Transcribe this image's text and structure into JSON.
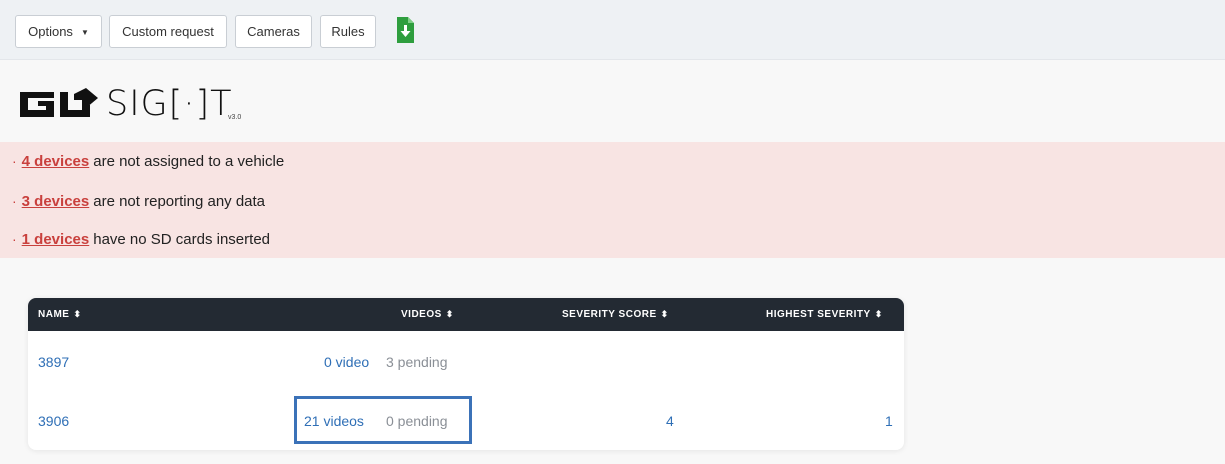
{
  "toolbar": {
    "options_label": "Options",
    "custom_request_label": "Custom request",
    "cameras_label": "Cameras",
    "rules_label": "Rules",
    "download_icon": "download-file-icon",
    "accent_color": "#2e9e3e"
  },
  "logo": {
    "word": "SIG[·]T",
    "version": "v3.0"
  },
  "alerts": [
    {
      "link": "4 devices",
      "text": "are not assigned to a vehicle"
    },
    {
      "link": "3 devices",
      "text": "are not reporting any data"
    },
    {
      "link": "1 devices",
      "text": "have no SD cards inserted"
    }
  ],
  "table": {
    "columns": [
      "NAME",
      "VIDEOS",
      "SEVERITY SCORE",
      "HIGHEST SEVERITY"
    ],
    "sort_icon": "⬍",
    "rows": [
      {
        "name": "3897",
        "videos": "0 video",
        "pending": "3 pending",
        "severity_score": "",
        "highest_severity": ""
      },
      {
        "name": "3906",
        "videos": "21 videos",
        "pending": "0 pending",
        "severity_score": "4",
        "highest_severity": "1"
      }
    ]
  },
  "colors": {
    "alert_bg": "#f8e4e3",
    "alert_link": "#c9403d",
    "table_header": "#232a33",
    "link_blue": "#2f6fb6",
    "highlight": "#3b72b8"
  }
}
